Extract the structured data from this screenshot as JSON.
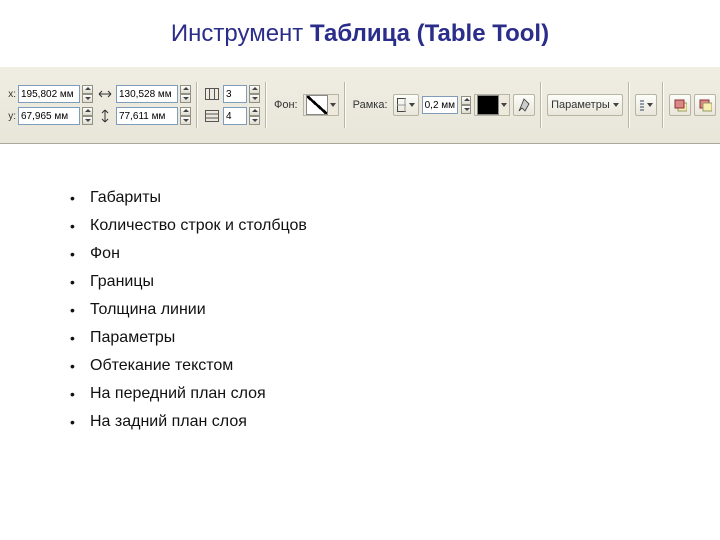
{
  "title": {
    "light": "Инструмент ",
    "bold": "Таблица (Table Tool)"
  },
  "toolbar": {
    "x_label": "x:",
    "y_label": "y:",
    "x_value": "195,802 мм",
    "y_value": "67,965 мм",
    "w_value": "130,528 мм",
    "h_value": "77,611 мм",
    "cols_value": "3",
    "rows_value": "4",
    "fill_label": "Фон:",
    "border_label": "Рамка:",
    "border_width": "0,2 мм",
    "params_label": "Параметры"
  },
  "bullets": [
    "Габариты",
    "Количество строк и столбцов",
    "Фон",
    "Границы",
    "Толщина линии",
    "Параметры",
    "Обтекание текстом",
    "На передний план слоя",
    "На задний план слоя"
  ]
}
